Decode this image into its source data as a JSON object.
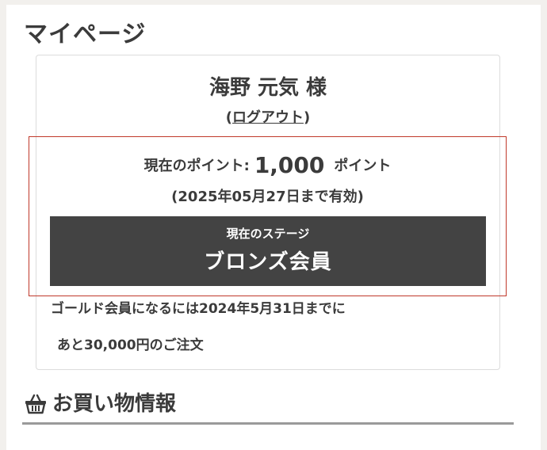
{
  "page": {
    "title": "マイページ"
  },
  "user": {
    "name": "海野 元気 様",
    "logout_open": "(",
    "logout_label": "ログアウト",
    "logout_close": ")"
  },
  "points": {
    "label": "現在のポイント:",
    "value": "1,000",
    "unit": "ポイント",
    "expiry": "(2025年05月27日まで有効)"
  },
  "stage": {
    "label": "現在のステージ",
    "name": "ブロンズ会員"
  },
  "notice": {
    "line1": "ゴールド会員になるには2024年5月31日までに",
    "line2": "あと30,000円のご注文"
  },
  "shopping": {
    "title": "お買い物情報",
    "icon": "basket-icon"
  },
  "colors": {
    "background": "#f2f0ed",
    "stage_bar": "#434343",
    "highlight_border": "#c0392b",
    "text": "#3b3b3b"
  }
}
